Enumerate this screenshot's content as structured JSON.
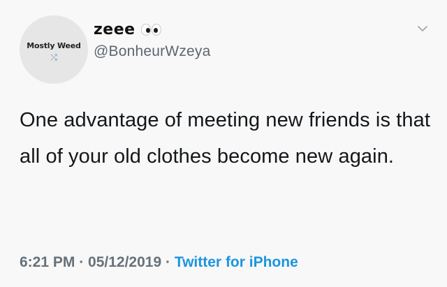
{
  "profile": {
    "avatar_text": "Mostly Weed",
    "avatar_mark": "⤭",
    "display_name": "zeee",
    "emoji_icon": "eyes-emoji-icon",
    "handle": "@BonheurWzeya"
  },
  "tweet": {
    "text": "One advantage of meeting new friends is that all of your old clothes become new again."
  },
  "meta": {
    "time": "6:21 PM",
    "separator_1": " · ",
    "date": "05/12/2019",
    "separator_2": " · ",
    "source": "Twitter for iPhone"
  },
  "colors": {
    "background": "#f8f8f8",
    "text": "#14171a",
    "secondary": "#5b6670",
    "link": "#1b95e0"
  },
  "icons": {
    "menu": "chevron-down-icon"
  }
}
